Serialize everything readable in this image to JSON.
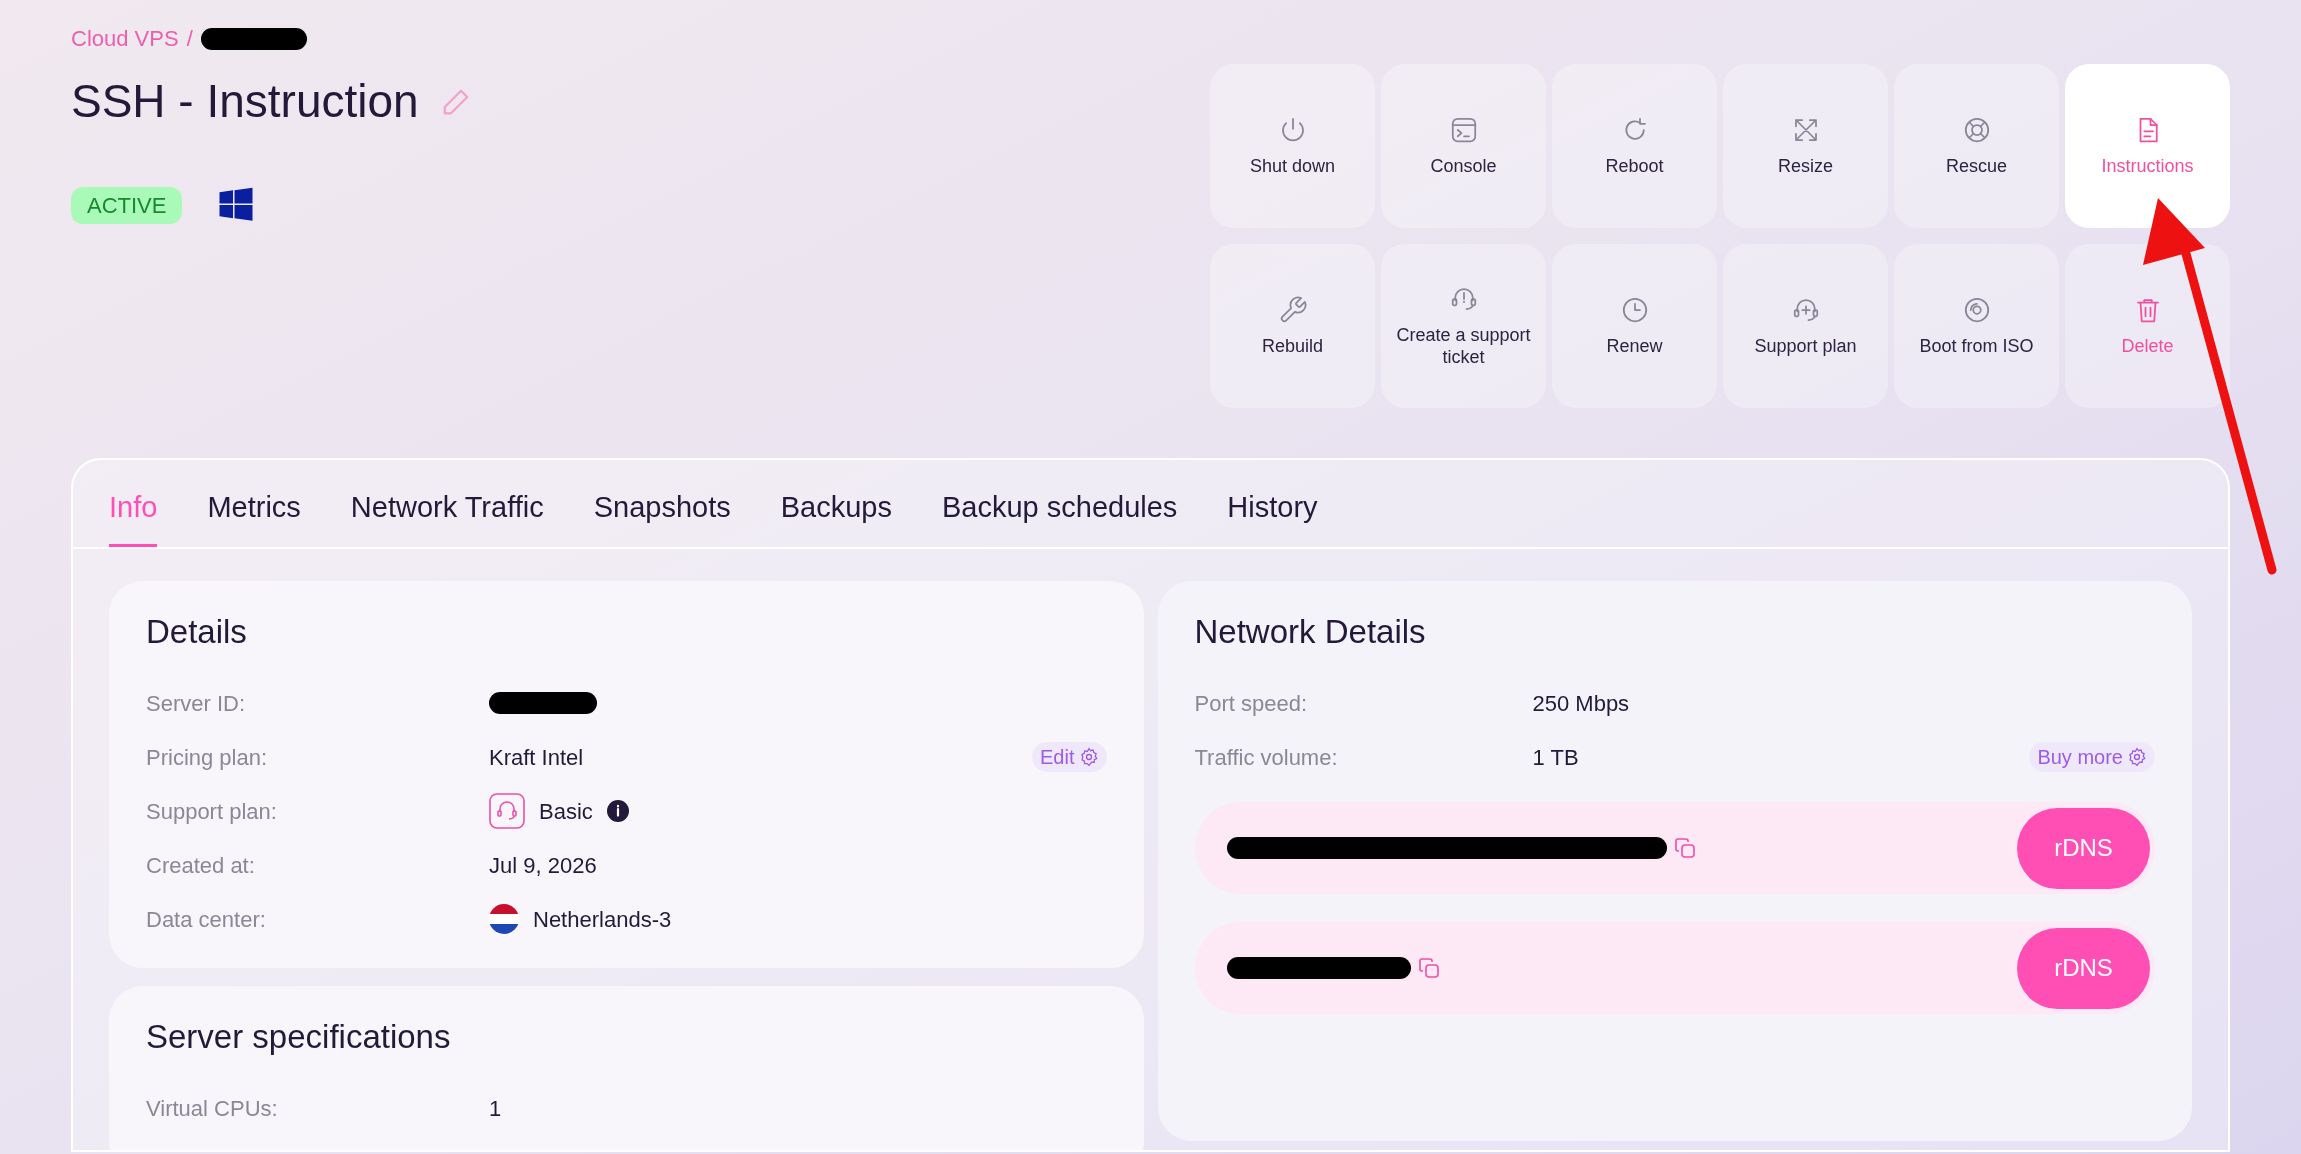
{
  "breadcrumb": {
    "section": "Cloud VPS",
    "separator": "/"
  },
  "title": "SSH - Instruction",
  "status": {
    "label": "ACTIVE"
  },
  "actions": [
    {
      "label": "Shut down",
      "kind": "normal",
      "selected": false
    },
    {
      "label": "Console",
      "kind": "normal",
      "selected": false
    },
    {
      "label": "Reboot",
      "kind": "normal",
      "selected": false
    },
    {
      "label": "Resize",
      "kind": "normal",
      "selected": false
    },
    {
      "label": "Rescue",
      "kind": "normal",
      "selected": false
    },
    {
      "label": "Instructions",
      "kind": "normal",
      "selected": true
    },
    {
      "label": "Rebuild",
      "kind": "normal",
      "selected": false
    },
    {
      "label": "Create a support ticket",
      "kind": "normal",
      "selected": false
    },
    {
      "label": "Renew",
      "kind": "normal",
      "selected": false
    },
    {
      "label": "Support plan",
      "kind": "normal",
      "selected": false
    },
    {
      "label": "Boot from ISO",
      "kind": "normal",
      "selected": false
    },
    {
      "label": "Delete",
      "kind": "danger",
      "selected": false
    }
  ],
  "tabs": [
    {
      "label": "Info",
      "selected": true
    },
    {
      "label": "Metrics",
      "selected": false
    },
    {
      "label": "Network Traffic",
      "selected": false
    },
    {
      "label": "Snapshots",
      "selected": false
    },
    {
      "label": "Backups",
      "selected": false
    },
    {
      "label": "Backup schedules",
      "selected": false
    },
    {
      "label": "History",
      "selected": false
    }
  ],
  "details": {
    "title": "Details",
    "rows": [
      {
        "label": "Server ID:",
        "kind": "redacted"
      },
      {
        "label": "Pricing plan:",
        "kind": "text",
        "value": "Kraft Intel",
        "action": "Edit"
      },
      {
        "label": "Support plan:",
        "kind": "support",
        "value": "Basic"
      },
      {
        "label": "Created at:",
        "kind": "text",
        "value": "Jul 9, 2026"
      },
      {
        "label": "Data center:",
        "kind": "flag",
        "value": "Netherlands-3"
      }
    ]
  },
  "specs": {
    "title": "Server specifications",
    "rows": [
      {
        "label": "Virtual CPUs:",
        "kind": "text",
        "value": "1"
      }
    ]
  },
  "network": {
    "title": "Network Details",
    "rows": [
      {
        "label": "Port speed:",
        "kind": "text",
        "value": "250 Mbps"
      },
      {
        "label": "Traffic volume:",
        "kind": "text",
        "value": "1 TB",
        "action": "Buy more"
      }
    ],
    "addresses": [
      {
        "button": "rDNS",
        "kind": "long"
      },
      {
        "button": "rDNS",
        "kind": "short"
      }
    ]
  }
}
